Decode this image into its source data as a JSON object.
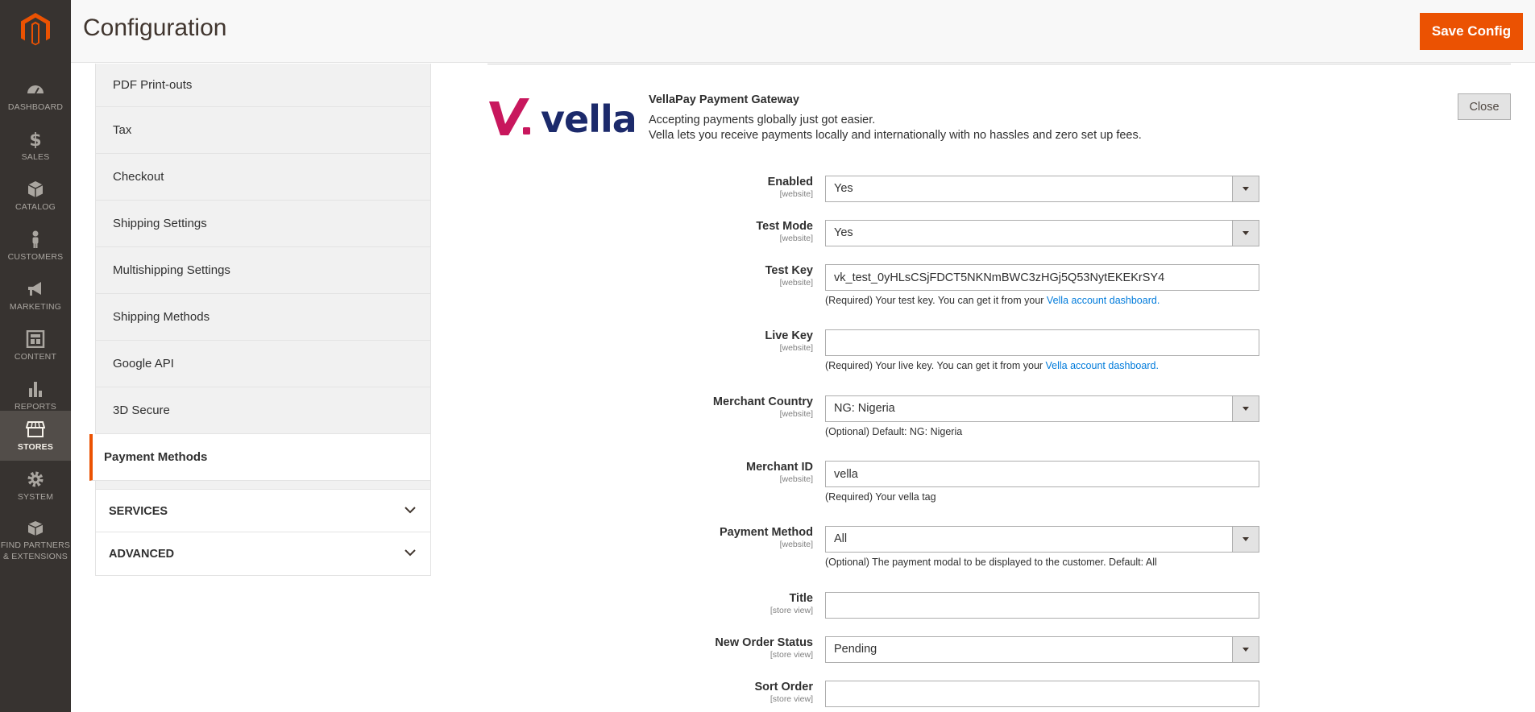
{
  "nav": {
    "items": [
      {
        "label": "Dashboard",
        "icon": "dashboard-icon"
      },
      {
        "label": "Sales",
        "icon": "dollar-icon"
      },
      {
        "label": "Catalog",
        "icon": "box-icon"
      },
      {
        "label": "Customers",
        "icon": "person-icon"
      },
      {
        "label": "Marketing",
        "icon": "megaphone-icon"
      },
      {
        "label": "Content",
        "icon": "layout-icon"
      },
      {
        "label": "Reports",
        "icon": "bar-chart-icon"
      },
      {
        "label": "Stores",
        "icon": "store-icon"
      },
      {
        "label": "System",
        "icon": "gear-icon"
      },
      {
        "label": "Find Partners & Extensions",
        "icon": "boxes-icon"
      }
    ],
    "active": "Stores",
    "accent": "#eb5202"
  },
  "header": {
    "title": "Configuration",
    "save_label": "Save Config"
  },
  "tabs": {
    "items": [
      "PDF Print-outs",
      "Tax",
      "Checkout",
      "Shipping Settings",
      "Multishipping Settings",
      "Shipping Methods",
      "Google API",
      "3D Secure",
      "Payment Methods"
    ],
    "active": "Payment Methods",
    "sections": [
      "Services",
      "Advanced"
    ]
  },
  "gateway": {
    "logo_text": "vella",
    "title": "VellaPay Payment Gateway",
    "desc_line1": "Accepting payments globally just got easier.",
    "desc_line2": "Vella lets you receive payments locally and internationally with no hassles and zero set up fees.",
    "close_label": "Close",
    "brand_color": "#c8175d",
    "brand_text_color": "#1c2a6b"
  },
  "form": {
    "enabled": {
      "label": "Enabled",
      "scope": "[website]",
      "value": "Yes"
    },
    "test_mode": {
      "label": "Test Mode",
      "scope": "[website]",
      "value": "Yes"
    },
    "test_key": {
      "label": "Test Key",
      "scope": "[website]",
      "value": "vk_test_0yHLsCSjFDCT5NKNmBWC3zHGj5Q53NytEKEKrSY4",
      "note": "(Required) Your test key. You can get it from your ",
      "note_link": "Vella account dashboard."
    },
    "live_key": {
      "label": "Live Key",
      "scope": "[website]",
      "value": "",
      "note": "(Required) Your live key. You can get it from your ",
      "note_link": "Vella account dashboard."
    },
    "merchant_country": {
      "label": "Merchant Country",
      "scope": "[website]",
      "value": "NG: Nigeria",
      "note": "(Optional) Default: NG: Nigeria"
    },
    "merchant_id": {
      "label": "Merchant ID",
      "scope": "[website]",
      "value": "vella",
      "note": "(Required) Your vella tag"
    },
    "payment_method": {
      "label": "Payment Method",
      "scope": "[website]",
      "value": "All",
      "note": "(Optional) The payment modal to be displayed to the customer. Default: All"
    },
    "title": {
      "label": "Title",
      "scope": "[store view]",
      "value": ""
    },
    "new_order_status": {
      "label": "New Order Status",
      "scope": "[store view]",
      "value": "Pending"
    },
    "sort_order": {
      "label": "Sort Order",
      "scope": "[store view]",
      "value": ""
    }
  }
}
